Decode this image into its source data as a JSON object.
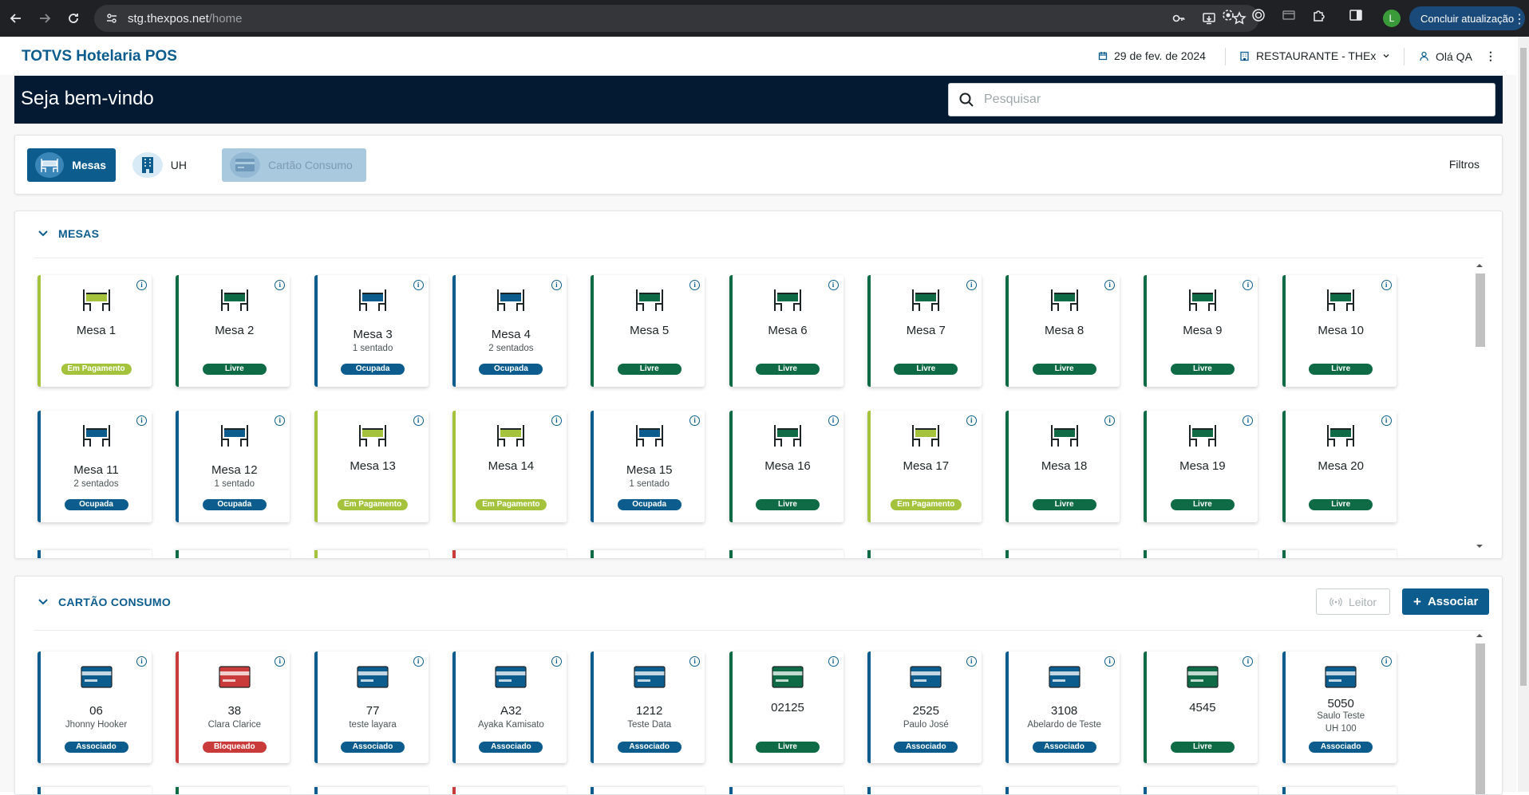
{
  "browser": {
    "url_host": "stg.thexpos.net",
    "url_path": "/home",
    "profile_initial": "L",
    "update_label": "Concluir atualização"
  },
  "app": {
    "brand": "TOTVS Hotelaria POS",
    "date": "29 de fev. de 2024",
    "outlet": "RESTAURANTE - THEx",
    "user_greeting": "Olá QA",
    "welcome": "Seja bem-vindo",
    "search_placeholder": "Pesquisar"
  },
  "filterbar": {
    "tabs": [
      {
        "label": "Mesas",
        "state": "active"
      },
      {
        "label": "UH",
        "state": "normal"
      },
      {
        "label": "Cartão Consumo",
        "state": "disabled"
      }
    ],
    "filters_label": "Filtros"
  },
  "status_colors": {
    "Livre": "#0f6b45",
    "Ocupada": "#0c5d8e",
    "Em Pagamento": "#a4c23c",
    "Associado": "#0c5d8e",
    "Bloqueado": "#c93b3b"
  },
  "mesas": {
    "title": "MESAS",
    "tables": [
      {
        "name": "Mesa 1",
        "sub": "",
        "status": "Em Pagamento"
      },
      {
        "name": "Mesa 2",
        "sub": "",
        "status": "Livre"
      },
      {
        "name": "Mesa 3",
        "sub": "1 sentado",
        "status": "Ocupada"
      },
      {
        "name": "Mesa 4",
        "sub": "2 sentados",
        "status": "Ocupada"
      },
      {
        "name": "Mesa 5",
        "sub": "",
        "status": "Livre"
      },
      {
        "name": "Mesa 6",
        "sub": "",
        "status": "Livre"
      },
      {
        "name": "Mesa 7",
        "sub": "",
        "status": "Livre"
      },
      {
        "name": "Mesa 8",
        "sub": "",
        "status": "Livre"
      },
      {
        "name": "Mesa 9",
        "sub": "",
        "status": "Livre"
      },
      {
        "name": "Mesa 10",
        "sub": "",
        "status": "Livre"
      },
      {
        "name": "Mesa 11",
        "sub": "2 sentados",
        "status": "Ocupada"
      },
      {
        "name": "Mesa 12",
        "sub": "1 sentado",
        "status": "Ocupada"
      },
      {
        "name": "Mesa 13",
        "sub": "",
        "status": "Em Pagamento"
      },
      {
        "name": "Mesa 14",
        "sub": "",
        "status": "Em Pagamento"
      },
      {
        "name": "Mesa 15",
        "sub": "1 sentado",
        "status": "Ocupada"
      },
      {
        "name": "Mesa 16",
        "sub": "",
        "status": "Livre"
      },
      {
        "name": "Mesa 17",
        "sub": "",
        "status": "Em Pagamento"
      },
      {
        "name": "Mesa 18",
        "sub": "",
        "status": "Livre"
      },
      {
        "name": "Mesa 19",
        "sub": "",
        "status": "Livre"
      },
      {
        "name": "Mesa 20",
        "sub": "",
        "status": "Livre"
      }
    ],
    "partial_row_colors": [
      "#0c5d8e",
      "#0f6b45",
      "#a4c23c",
      "#c93b3b",
      "#0f6b45",
      "#0f6b45",
      "#0f6b45",
      "#0f6b45",
      "#0f6b45",
      "#0f6b45"
    ]
  },
  "cartao": {
    "title": "CARTÃO CONSUMO",
    "leitor_label": "Leitor",
    "associar_label": "Associar",
    "cards": [
      {
        "number": "06",
        "holder": "Jhonny Hooker",
        "extra": "",
        "status": "Associado"
      },
      {
        "number": "38",
        "holder": "Clara Clarice",
        "extra": "",
        "status": "Bloqueado"
      },
      {
        "number": "77",
        "holder": "teste layara",
        "extra": "",
        "status": "Associado"
      },
      {
        "number": "A32",
        "holder": "Ayaka Kamisato",
        "extra": "",
        "status": "Associado"
      },
      {
        "number": "1212",
        "holder": "Teste Data",
        "extra": "",
        "status": "Associado"
      },
      {
        "number": "02125",
        "holder": "",
        "extra": "",
        "status": "Livre"
      },
      {
        "number": "2525",
        "holder": "Paulo José",
        "extra": "",
        "status": "Associado"
      },
      {
        "number": "3108",
        "holder": "Abelardo de Teste",
        "extra": "",
        "status": "Associado"
      },
      {
        "number": "4545",
        "holder": "",
        "extra": "",
        "status": "Livre"
      },
      {
        "number": "5050",
        "holder": "Saulo Teste",
        "extra": "UH 100",
        "status": "Associado"
      }
    ]
  }
}
